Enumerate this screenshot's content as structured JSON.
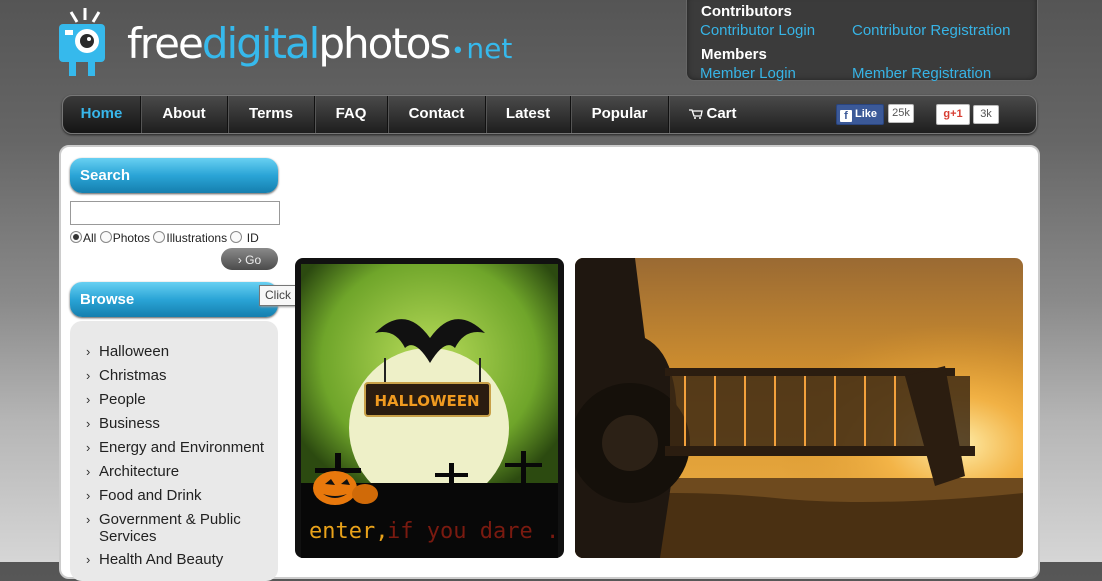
{
  "logo": {
    "text_free": "free",
    "text_digital": "digital",
    "text_photos": "photos",
    "text_dot": "•",
    "text_net": "net"
  },
  "account": {
    "contributors_heading": "Contributors",
    "contributor_login": "Contributor Login",
    "contributor_registration": "Contributor Registration",
    "members_heading": "Members",
    "member_login": "Member Login",
    "member_registration": "Member Registration"
  },
  "nav": {
    "items": [
      "Home",
      "About",
      "Terms",
      "FAQ",
      "Contact",
      "Latest",
      "Popular",
      "Cart"
    ],
    "active": "Home"
  },
  "social": {
    "fb_label": "Like",
    "fb_letter": "f",
    "fb_count": "25k",
    "gplus_label": "g+1",
    "gplus_count": "3k"
  },
  "search": {
    "heading": "Search",
    "input_value": "",
    "options": [
      "All",
      "Photos",
      "Illustrations",
      "ID"
    ],
    "selected": "All",
    "go_label": "Go",
    "tooltip": "Click button to search"
  },
  "browse": {
    "heading": "Browse",
    "categories": [
      "Halloween",
      "Christmas",
      "People",
      "Business",
      "Energy and Environment",
      "Architecture",
      "Food and Drink",
      "Government & Public Services",
      "Health And Beauty"
    ]
  },
  "featured": {
    "halloween_banner": "HALLOWEEN",
    "halloween_tagline_1": "enter,",
    "halloween_tagline_2": "if you dare ..."
  },
  "colors": {
    "accent": "#36b9ec",
    "nav_bg": "#1e1e1e",
    "head_blue": "#2aa4d6",
    "fb_blue": "#3b5998",
    "gplus_red": "#d73d32"
  }
}
